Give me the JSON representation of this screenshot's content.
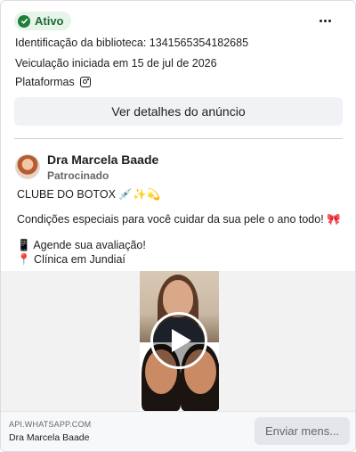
{
  "status": {
    "label": "Ativo",
    "icon": "check-circle-icon",
    "color": "#1e7f3a"
  },
  "meta": {
    "library_id": "Identificação da biblioteca: 1341565354182685",
    "started": "Veiculação iniciada em 15 de jul de 2026",
    "platforms_label": "Plataformas",
    "platform_icon": "instagram-icon"
  },
  "details_button": "Ver detalhes do anúncio",
  "ad": {
    "page_name": "Dra Marcela Baade",
    "sponsored": "Patrocinado",
    "lines": [
      "CLUBE DO BOTOX 💉✨💫",
      "Condições especiais para você cuidar da sua pele o ano todo! 🎀",
      "📱 Agende sua avaliação!",
      "📍 Clínica em Jundiaí"
    ]
  },
  "footer": {
    "domain": "API.WHATSAPP.COM",
    "name": "Dra Marcela Baade",
    "cta": "Enviar mens..."
  }
}
